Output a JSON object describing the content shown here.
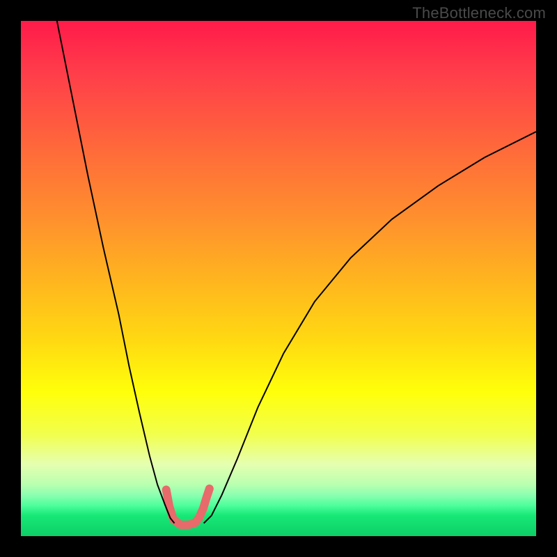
{
  "watermark": "TheBottleneck.com",
  "chart_data": {
    "type": "line",
    "title": "",
    "xlabel": "",
    "ylabel": "",
    "xlim": [
      0,
      100
    ],
    "ylim": [
      0,
      100
    ],
    "grid": false,
    "legend": false,
    "series": [
      {
        "name": "left-branch",
        "stroke": "#000000",
        "stroke_width": 2,
        "x": [
          7,
          10,
          13,
          16,
          19,
          21,
          23,
          25,
          26.5,
          28,
          29,
          29.8
        ],
        "y": [
          100,
          85,
          70,
          56,
          43,
          33,
          24,
          15.5,
          10,
          6,
          3.5,
          2.5
        ]
      },
      {
        "name": "right-branch",
        "stroke": "#000000",
        "stroke_width": 2,
        "x": [
          35.5,
          37,
          39,
          42,
          46,
          51,
          57,
          64,
          72,
          81,
          90,
          100
        ],
        "y": [
          2.5,
          4,
          8,
          15,
          25,
          35.5,
          45.5,
          54,
          61.5,
          68,
          73.5,
          78.5
        ]
      },
      {
        "name": "pink-marker",
        "stroke": "#e86a6a",
        "stroke_width": 12,
        "linecap": "round",
        "x": [
          28.2,
          28.8,
          29.6,
          31,
          32.6,
          33.8,
          34.6,
          35.4,
          36.0,
          36.6
        ],
        "y": [
          9,
          5.8,
          3.2,
          2.2,
          2.2,
          2.6,
          3.6,
          5.4,
          7.4,
          9.2
        ]
      }
    ]
  }
}
